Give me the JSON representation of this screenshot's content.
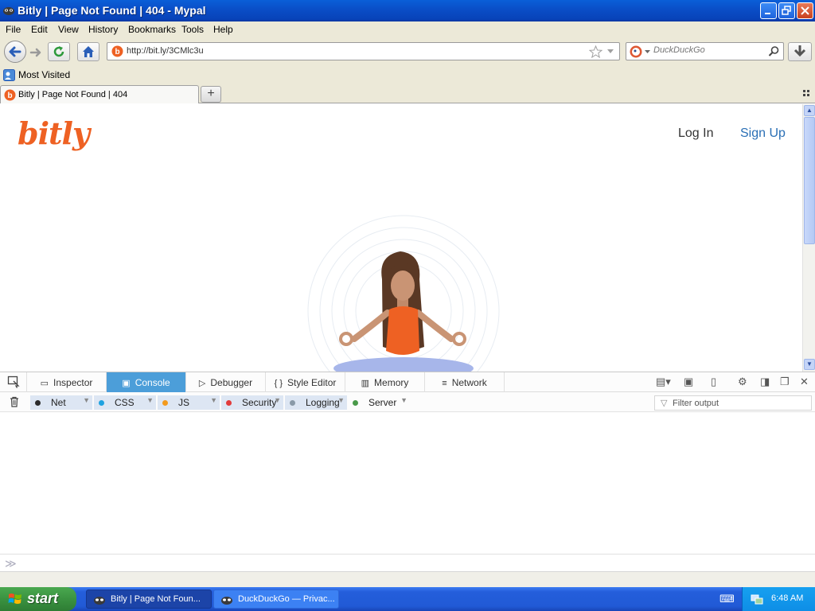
{
  "window": {
    "title": "Bitly | Page Not Found | 404 - Mypal"
  },
  "menu": [
    "File",
    "Edit",
    "View",
    "History",
    "Bookmarks",
    "Tools",
    "Help"
  ],
  "nav": {
    "url": "http://bit.ly/3CMlc3u",
    "search_placeholder": "DuckDuckGo"
  },
  "bookmarks": {
    "most_visited": "Most Visited"
  },
  "tab": {
    "label": "Bitly | Page Not Found | 404",
    "new_tab_symbol": "+"
  },
  "page": {
    "logo": "bitly",
    "log_in": "Log In",
    "sign_up": "Sign Up",
    "brand_color": "#ee6123",
    "link_color": "#2a6fb5"
  },
  "devtools": {
    "tabs": [
      {
        "label": "Inspector",
        "icon": "inspector-icon"
      },
      {
        "label": "Console",
        "icon": "console-icon"
      },
      {
        "label": "Debugger",
        "icon": "debugger-icon"
      },
      {
        "label": "Style Editor",
        "icon": "style-editor-icon"
      },
      {
        "label": "Memory",
        "icon": "memory-icon"
      },
      {
        "label": "Network",
        "icon": "network-icon"
      }
    ],
    "active_tab": "Console",
    "filters": [
      {
        "label": "Net",
        "color": "#2b2b2b",
        "on": true
      },
      {
        "label": "CSS",
        "color": "#1fa2e0",
        "on": true
      },
      {
        "label": "JS",
        "color": "#f39a1d",
        "on": true
      },
      {
        "label": "Security",
        "color": "#e23b3b",
        "on": true
      },
      {
        "label": "Logging",
        "color": "#8a9aa8",
        "on": true
      },
      {
        "label": "Server",
        "color": "#4a9a4a",
        "on": false
      }
    ],
    "filter_output_placeholder": "Filter output",
    "accent_color": "#4c9ed9"
  },
  "taskbar": {
    "start": "start",
    "tasks": [
      {
        "label": "Bitly | Page Not Foun...",
        "active": true
      },
      {
        "label": "DuckDuckGo — Privac...",
        "active": false
      }
    ],
    "clock": "6:48 AM"
  }
}
